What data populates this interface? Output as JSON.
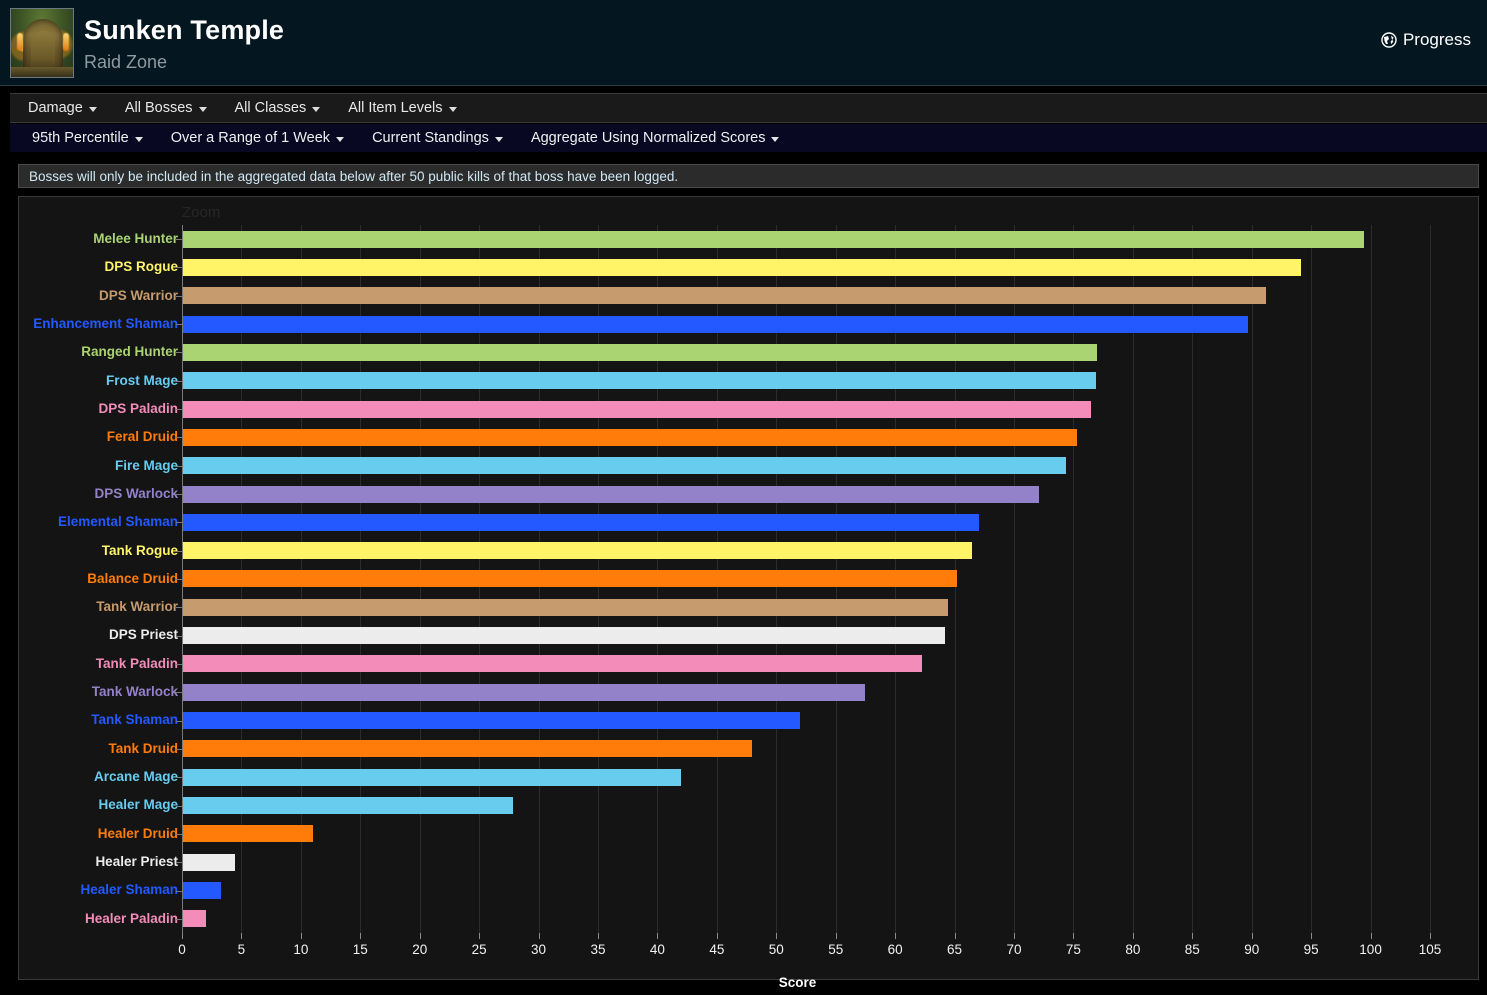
{
  "header": {
    "title": "Sunken Temple",
    "subtitle": "Raid Zone",
    "progress_label": "Progress",
    "thumb_name": "zone-thumbnail"
  },
  "toolbar_primary": {
    "items": [
      {
        "label": "Damage",
        "name": "metric-dropdown"
      },
      {
        "label": "All Bosses",
        "name": "boss-dropdown"
      },
      {
        "label": "All Classes",
        "name": "class-dropdown"
      },
      {
        "label": "All Item Levels",
        "name": "item-level-dropdown"
      }
    ]
  },
  "toolbar_secondary": {
    "items": [
      {
        "label": "95th Percentile",
        "name": "percentile-dropdown"
      },
      {
        "label": "Over a Range of 1 Week",
        "name": "time-range-dropdown"
      },
      {
        "label": "Current Standings",
        "name": "standings-dropdown"
      },
      {
        "label": "Aggregate Using Normalized Scores",
        "name": "aggregation-dropdown"
      }
    ]
  },
  "notice": {
    "text": "Bosses will only be included in the aggregated data below after 50 public kills of that boss have been logged."
  },
  "chart_panel": {
    "zoom_label": "Zoom"
  },
  "colors": {
    "hunter": "#aad372",
    "rogue": "#fff468",
    "warrior": "#c69b6d",
    "shaman": "#2359ff",
    "mage": "#68ccef",
    "paladin": "#f48cba",
    "druid": "#ff7c0a",
    "warlock": "#9382c9",
    "priest": "#ececec",
    "background": "#141414",
    "gridline": "#2c2c2c",
    "axis": "#7b7b7b",
    "header_bg": "#04161f",
    "toolbar1_bg": "#1a1a1a",
    "toolbar2_bg": "#080822",
    "notice_bg": "#2b2b2b"
  },
  "chart_data": {
    "type": "bar",
    "orientation": "horizontal",
    "title": "",
    "xlabel": "Score",
    "ylabel": "",
    "xlim": [
      0,
      105
    ],
    "xticks": [
      0,
      5,
      10,
      15,
      20,
      25,
      30,
      35,
      40,
      45,
      50,
      55,
      60,
      65,
      70,
      75,
      80,
      85,
      90,
      95,
      100,
      105
    ],
    "grid": true,
    "legend": "none",
    "categories": [
      "Melee Hunter",
      "DPS Rogue",
      "DPS Warrior",
      "Enhancement Shaman",
      "Ranged Hunter",
      "Frost Mage",
      "DPS Paladin",
      "Feral Druid",
      "Fire Mage",
      "DPS Warlock",
      "Elemental Shaman",
      "Tank Rogue",
      "Balance Druid",
      "Tank Warrior",
      "DPS Priest",
      "Tank Paladin",
      "Tank Warlock",
      "Tank Shaman",
      "Tank Druid",
      "Arcane Mage",
      "Healer Mage",
      "Healer Druid",
      "Healer Priest",
      "Healer Shaman",
      "Healer Paladin"
    ],
    "values": [
      99.4,
      94.1,
      91.1,
      89.6,
      76.9,
      76.8,
      76.4,
      75.2,
      74.3,
      72.0,
      67.0,
      66.4,
      65.1,
      64.4,
      64.1,
      62.2,
      57.4,
      51.9,
      47.9,
      41.9,
      27.8,
      10.9,
      4.4,
      3.2,
      1.9
    ],
    "bar_colors": [
      "#aad372",
      "#fff468",
      "#c69b6d",
      "#2359ff",
      "#aad372",
      "#68ccef",
      "#f48cba",
      "#ff7c0a",
      "#68ccef",
      "#9382c9",
      "#2359ff",
      "#fff468",
      "#ff7c0a",
      "#c69b6d",
      "#ececec",
      "#f48cba",
      "#9382c9",
      "#2359ff",
      "#ff7c0a",
      "#68ccef",
      "#68ccef",
      "#ff7c0a",
      "#ececec",
      "#2359ff",
      "#f48cba"
    ]
  }
}
